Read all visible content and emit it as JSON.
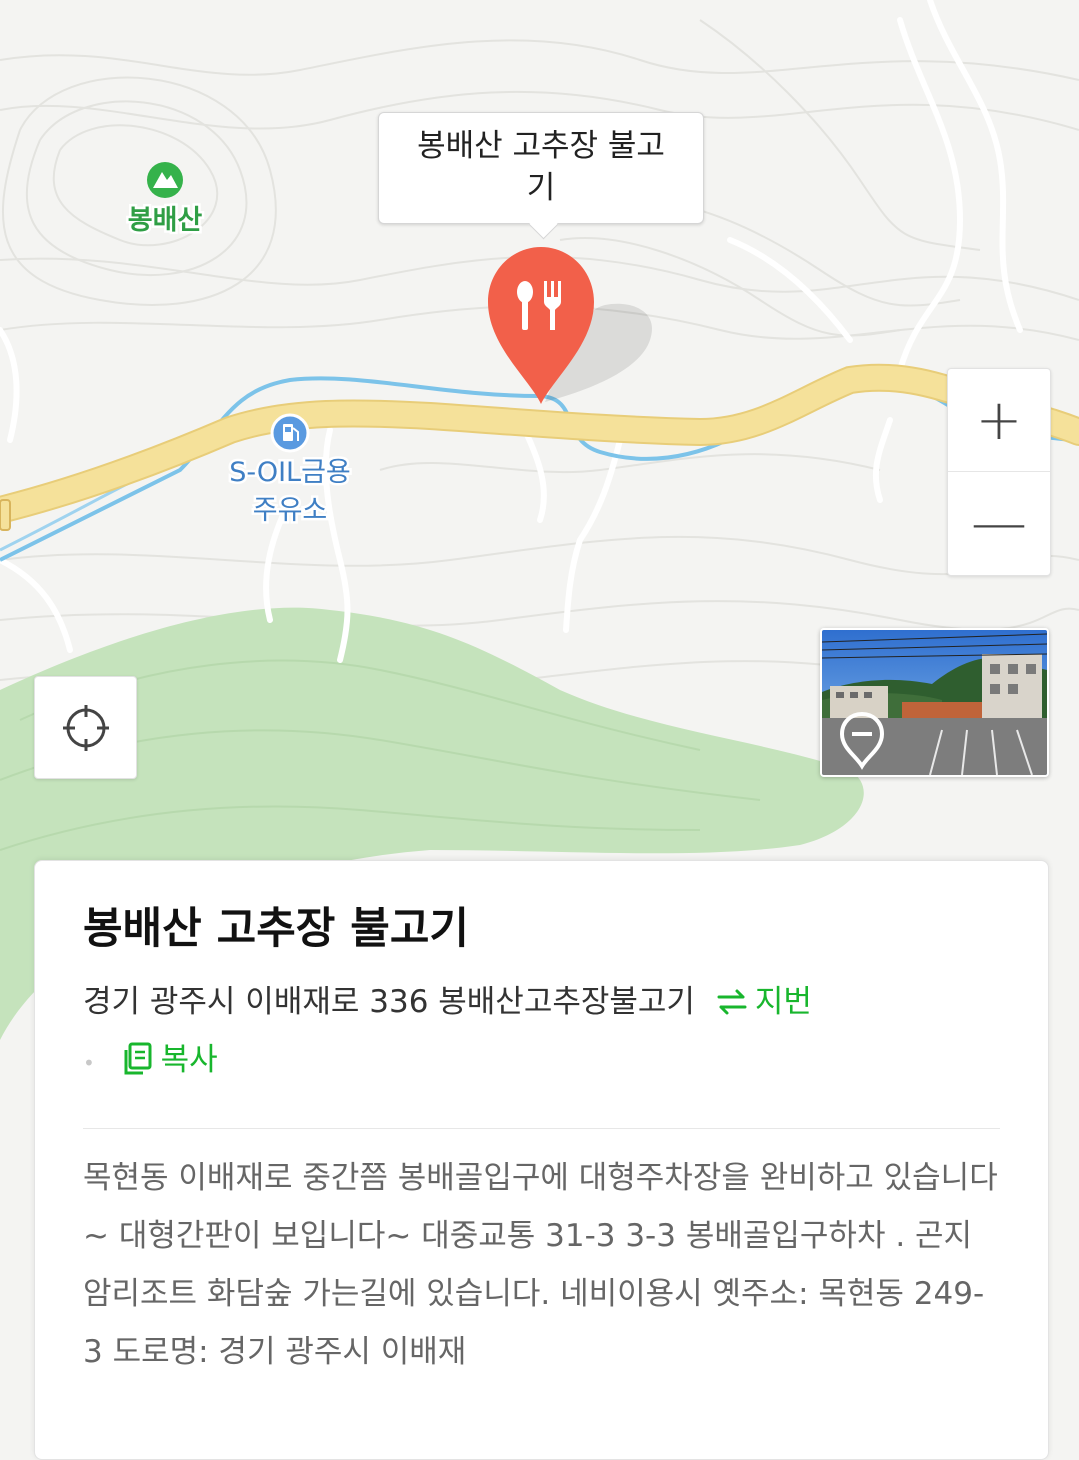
{
  "map": {
    "mountain_label": "봉배산",
    "gas_station_label_line1": "S-OIL금용",
    "gas_station_label_line2": "주유소",
    "colors": {
      "land": "#f4f4f2",
      "road": "#f5e19a",
      "water": "#7cc3e9",
      "forest": "#c5e3bc",
      "pin": "#f2604a",
      "mountain_icon": "#35b24b",
      "gas_icon": "#5a9ae0"
    }
  },
  "callout": {
    "title_line1": "봉배산 고추장 불고",
    "title_line2": "기"
  },
  "controls": {
    "zoom_in": "+",
    "zoom_out": "—"
  },
  "card": {
    "title": "봉배산 고추장 불고기",
    "address": "경기 광주시 이배재로 336 봉배산고추장불고기",
    "jibun_label": "지번",
    "copy_label": "복사",
    "dot": "•",
    "description": "목현동 이배재로 중간쯤 봉배골입구에 대형주차장을 완비하고 있습니다~ 대형간판이 보입니다~ 대중교통 31-3 3-3 봉배골입구하차 . 곤지암리조트 화담숲 가는길에 있습니다. 네비이용시 옛주소: 목현동 249-3 도로명: 경기 광주시 이배재"
  }
}
